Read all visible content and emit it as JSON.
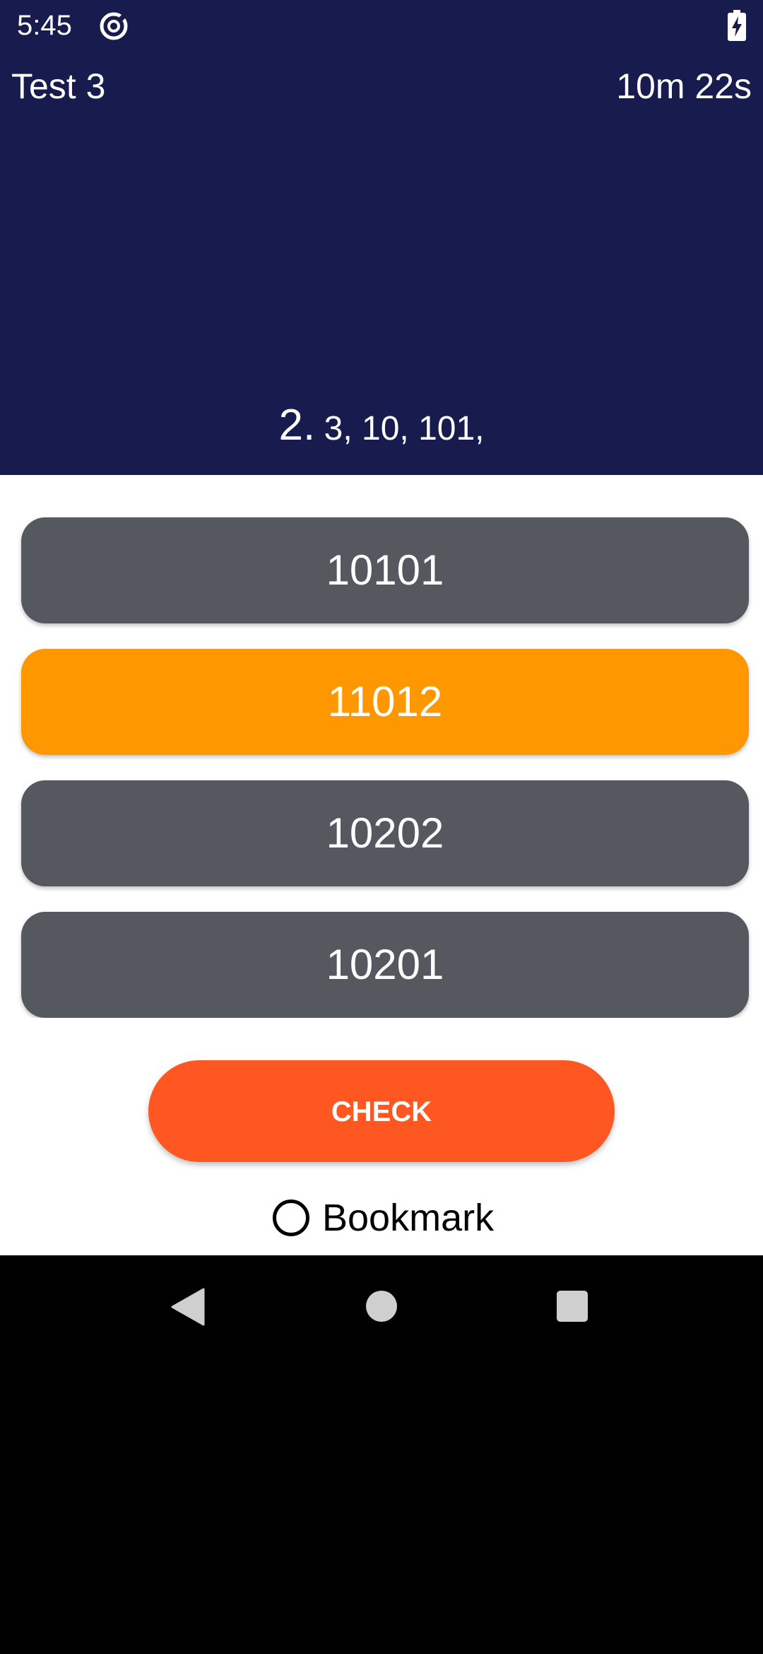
{
  "status_bar": {
    "time": "5:45",
    "app_icon": "data-saver-icon",
    "battery_icon": "battery-charging-icon"
  },
  "header": {
    "title": "Test 3",
    "timer": "10m 22s"
  },
  "question": {
    "number": "2.",
    "text": "3, 10, 101,"
  },
  "answers": [
    {
      "label": "10101",
      "selected": false
    },
    {
      "label": "11012",
      "selected": true
    },
    {
      "label": "10202",
      "selected": false
    },
    {
      "label": "10201",
      "selected": false
    }
  ],
  "actions": {
    "check_label": "CHECK",
    "bookmark_label": "Bookmark",
    "bookmark_checked": false
  },
  "nav_bar": {
    "back_icon": "back-triangle-icon",
    "home_icon": "home-circle-icon",
    "recents_icon": "recents-square-icon"
  },
  "colors": {
    "header_bg": "#171b4d",
    "answer_bg": "#55585f",
    "answer_selected_bg": "#ff9800",
    "check_button_bg": "#ff5722"
  }
}
